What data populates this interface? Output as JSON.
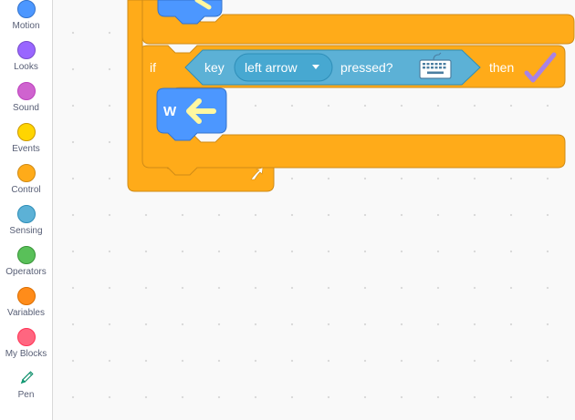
{
  "categories": [
    {
      "label": "Motion",
      "color": "#4c97ff"
    },
    {
      "label": "Looks",
      "color": "#9966ff"
    },
    {
      "label": "Sound",
      "color": "#cf63cf"
    },
    {
      "label": "Events",
      "color": "#ffd500"
    },
    {
      "label": "Control",
      "color": "#ffab19"
    },
    {
      "label": "Sensing",
      "color": "#5cb1d6"
    },
    {
      "label": "Operators",
      "color": "#59c059"
    },
    {
      "label": "Variables",
      "color": "#ff8c1a"
    },
    {
      "label": "My Blocks",
      "color": "#ff6680"
    },
    {
      "label": "Pen",
      "icon": "pen-icon"
    }
  ],
  "blocks": {
    "if_keyword": "if",
    "then_keyword": "then",
    "sensing_key_label": "key",
    "sensing_key_value": "left arrow",
    "sensing_pressed_label": "pressed?",
    "keyboard_icon": "keyboard-icon",
    "check_icon": "checkmark-icon",
    "inner_block_label": "W",
    "inner_block_icon": "left-arrow-icon",
    "loop_icon": "loop-arrow-icon"
  },
  "colors": {
    "control": "#ffab19",
    "control_border": "#cf8b17",
    "sensing": "#5cb1d6",
    "sensing_border": "#2e8eb8",
    "sensing_dropdown": "#47a8d1",
    "motion_ext": "#4c97ff",
    "arrow_yellow": "#fff7a0"
  }
}
